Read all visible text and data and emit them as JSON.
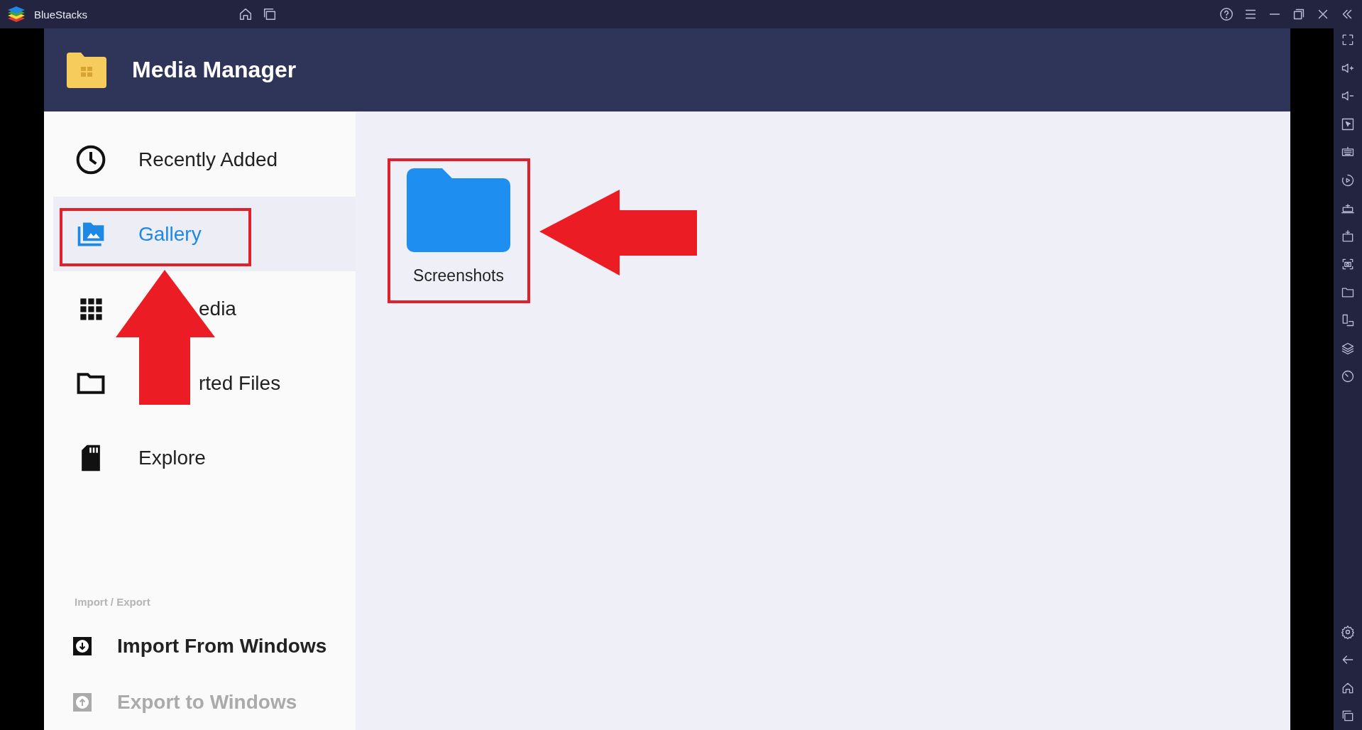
{
  "titlebar": {
    "title": "BlueStacks"
  },
  "app": {
    "title": "Media Manager"
  },
  "nav": [
    {
      "label": "Recently Added",
      "selected": false,
      "kind": "plain"
    },
    {
      "label": "Gallery",
      "selected": true,
      "kind": "plain"
    },
    {
      "label": "edia",
      "selected": false,
      "kind": "covered"
    },
    {
      "label": "rted Files",
      "selected": false,
      "kind": "covered"
    },
    {
      "label": "Explore",
      "selected": false,
      "kind": "plain"
    }
  ],
  "section_label": "Import / Export",
  "actions": [
    {
      "label": "Import From Windows",
      "disabled": false
    },
    {
      "label": "Export to Windows",
      "disabled": true
    }
  ],
  "folders": [
    {
      "name": "Screenshots"
    }
  ]
}
